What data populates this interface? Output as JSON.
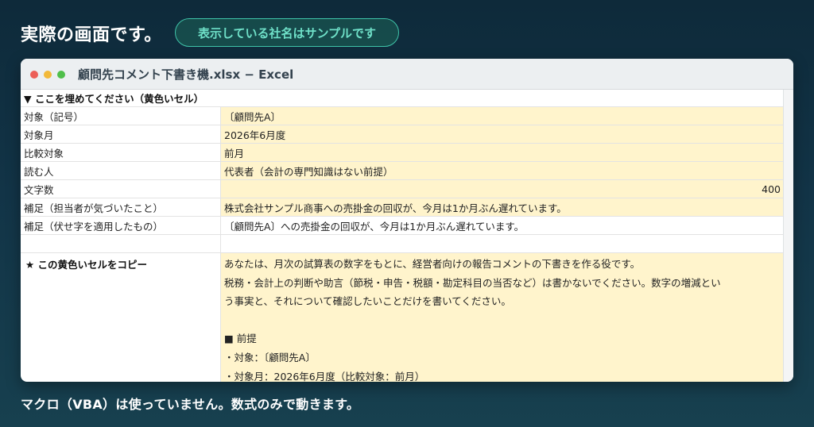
{
  "header": {
    "headline": "実際の画面です。",
    "badge": "表示している社名はサンプルです"
  },
  "window": {
    "title": "顧問先コメント下書き機.xlsx − Excel"
  },
  "sheet": {
    "section_header": "▼ ここを埋めてください（黄色いセル）",
    "rows": [
      {
        "label": "対象（記号）",
        "value": "〔顧問先A〕"
      },
      {
        "label": "対象月",
        "value": "2026年6月度"
      },
      {
        "label": "比較対象",
        "value": "前月"
      },
      {
        "label": "読む人",
        "value": "代表者（会計の専門知識はない前提）"
      },
      {
        "label": "文字数",
        "value": "400"
      },
      {
        "label": "補足（担当者が気づいたこと）",
        "value": "株式会社サンプル商事への売掛金の回収が、今月は1か月ぶん遅れています。"
      },
      {
        "label": "補足（伏せ字を適用したもの）",
        "value": "〔顧問先A〕への売掛金の回収が、今月は1か月ぶん遅れています。"
      }
    ],
    "copy_label": "★ この黄色いセルをコピー",
    "prompt_lines": [
      "あなたは、月次の試算表の数字をもとに、経営者向けの報告コメントの下書きを作る役です。",
      "税務・会計上の判断や助言（節税・申告・税額・勘定科目の当否など）は書かないでください。数字の増減とい",
      "う事実と、それについて確認したいことだけを書いてください。",
      "",
      "■ 前提",
      "・対象：〔顧問先A〕",
      "・対象月：2026年6月度（比較対象：前月）"
    ]
  },
  "footer": {
    "note": "マクロ（VBA）は使っていません。数式のみで動きます。"
  }
}
